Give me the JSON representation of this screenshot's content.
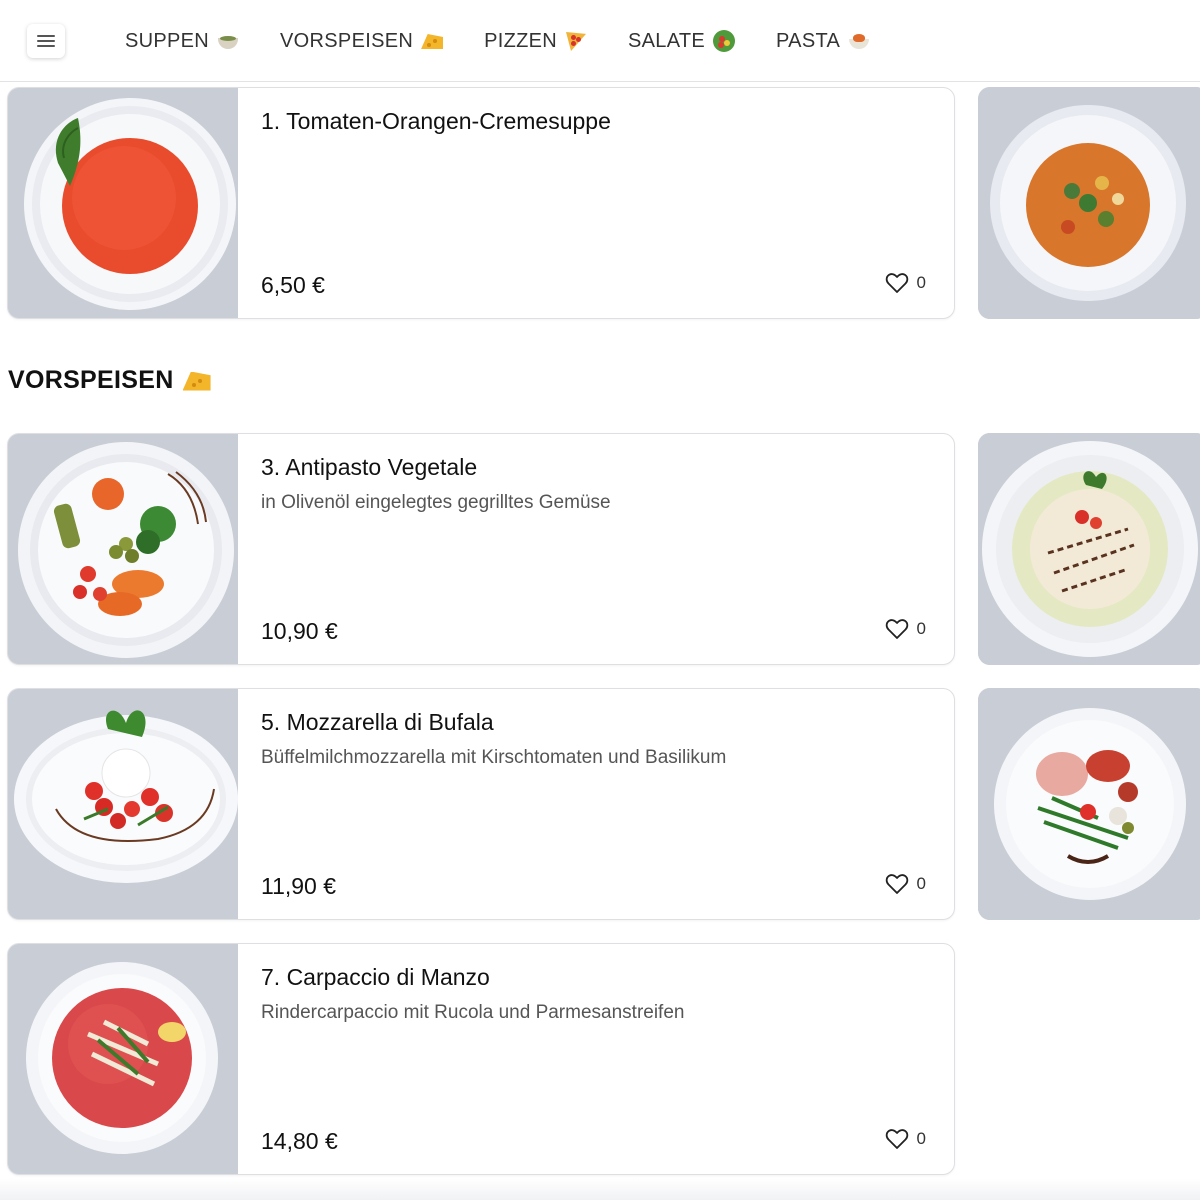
{
  "nav": {
    "menu_icon": "hamburger-menu-icon",
    "items": [
      {
        "label": "SUPPEN",
        "icon": "soup-bowl-icon"
      },
      {
        "label": "VORSPEISEN",
        "icon": "cheese-icon"
      },
      {
        "label": "PIZZEN",
        "icon": "pizza-slice-icon"
      },
      {
        "label": "SALATE",
        "icon": "salad-icon"
      },
      {
        "label": "PASTA",
        "icon": "pasta-bowl-icon"
      }
    ]
  },
  "suppen": {
    "items": [
      {
        "title": "1. Tomaten-Orangen-Cremesuppe",
        "description": "",
        "price": "6,50 €",
        "likes": "0"
      }
    ]
  },
  "vorspeisen": {
    "heading": "VORSPEISEN",
    "heading_icon": "cheese-icon",
    "items": [
      {
        "title": "3. Antipasto Vegetale",
        "description": "in Olivenöl eingelegtes gegrilltes Gemüse",
        "price": "10,90 €",
        "likes": "0"
      },
      {
        "title": "5. Mozzarella di Bufala",
        "description": "Büffelmilchmozzarella mit Kirschtomaten und Basilikum",
        "price": "11,90 €",
        "likes": "0"
      },
      {
        "title": "7. Carpaccio di Manzo",
        "description": "Rindercarpaccio mit Rucola und Parmesanstreifen",
        "price": "14,80 €",
        "likes": "0"
      }
    ]
  },
  "colors": {
    "photo_background": "#c7cbd4",
    "card_border": "#dedfe3",
    "text_primary": "#111111",
    "text_secondary": "#555555"
  }
}
